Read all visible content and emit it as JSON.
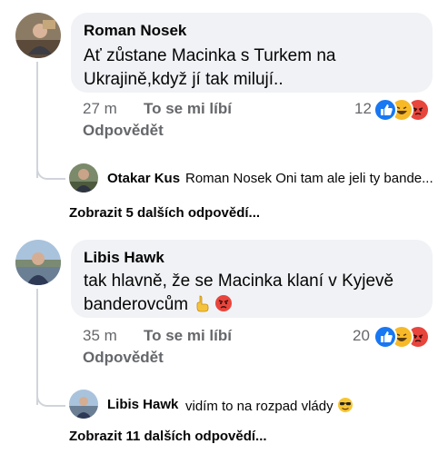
{
  "comments": [
    {
      "author": "Roman Nosek",
      "text_line1": "Ať zůstane Macinka s Turkem na",
      "text_line2": "Ukrajině,když jí tak milují..",
      "time": "27 m",
      "like_label": "To se mi líbí",
      "reply_label": "Odpovědět",
      "reaction_count": "12",
      "reactions": [
        "like-icon",
        "haha-icon",
        "angry-icon"
      ],
      "reply": {
        "author": "Otakar Kus",
        "text": "Roman Nosek Oni tam ale jeli ty bande..."
      },
      "more_replies": "Zobrazit 5 dalších odpovědí..."
    },
    {
      "author": "Libis Hawk",
      "text_line1": "tak hlavně, že se Macinka klaní v Kyjevě",
      "text_line2": "banderovcům",
      "inline_emojis": [
        "finger-point-icon",
        "angry-face-icon"
      ],
      "time": "35 m",
      "like_label": "To se mi líbí",
      "reply_label": "Odpovědět",
      "reaction_count": "20",
      "reactions": [
        "like-icon",
        "haha-icon",
        "angry-icon"
      ],
      "reply": {
        "author": "Libis Hawk",
        "text": "vidím to na rozpad vlády",
        "emoji": "sunglasses-face-icon"
      },
      "more_replies": "Zobrazit 11 dalších odpovědí..."
    }
  ],
  "colors": {
    "bubble": "#f0f2f5",
    "like_blue": "#1877f2",
    "angry_red": "#e8453c",
    "haha_yellow": "#f7b928",
    "meta_gray": "#65676b"
  }
}
